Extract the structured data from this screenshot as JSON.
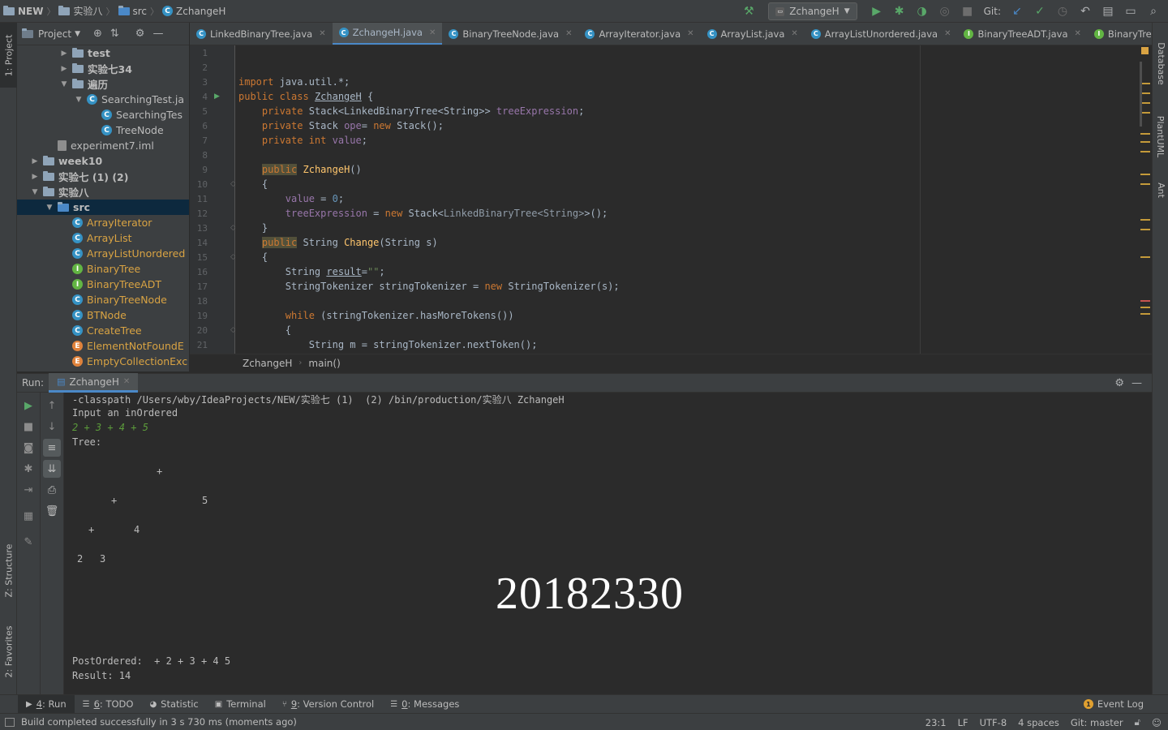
{
  "nav": {
    "crumbs": [
      "NEW",
      "实验八",
      "src",
      "ZchangeH"
    ],
    "run_config": "ZchangeH",
    "git_label": "Git:"
  },
  "left_strip": {
    "project": "1: Project",
    "structure": "Z: Structure",
    "favorites": "2: Favorites"
  },
  "right_strip": {
    "database": "Database",
    "plantuml": "PlantUML",
    "ant": "Ant"
  },
  "project_panel": {
    "title": "Project",
    "tree": [
      {
        "label": "test",
        "kind": "folder",
        "depth": 3,
        "arrow": "▶"
      },
      {
        "label": "实验七34",
        "kind": "folder",
        "depth": 3,
        "arrow": "▶"
      },
      {
        "label": "遍历",
        "kind": "folder",
        "depth": 3,
        "arrow": "▼"
      },
      {
        "label": "SearchingTest.ja",
        "kind": "class",
        "depth": 4,
        "arrow": "▼"
      },
      {
        "label": "SearchingTes",
        "kind": "class",
        "depth": 5,
        "arrow": ""
      },
      {
        "label": "TreeNode",
        "kind": "class",
        "depth": 5,
        "arrow": ""
      },
      {
        "label": "experiment7.iml",
        "kind": "iml",
        "depth": 2,
        "arrow": ""
      },
      {
        "label": "week10",
        "kind": "folder",
        "depth": 1,
        "arrow": "▶"
      },
      {
        "label": "实验七 (1)   (2)",
        "kind": "folder",
        "depth": 1,
        "arrow": "▶"
      },
      {
        "label": "实验八",
        "kind": "folder",
        "depth": 1,
        "arrow": "▼"
      },
      {
        "label": "src",
        "kind": "srcfolder",
        "depth": 2,
        "arrow": "▼"
      },
      {
        "label": "ArrayIterator",
        "kind": "java-c",
        "depth": 3,
        "arrow": ""
      },
      {
        "label": "ArrayList",
        "kind": "java-c",
        "depth": 3,
        "arrow": ""
      },
      {
        "label": "ArrayListUnordered",
        "kind": "java-c",
        "depth": 3,
        "arrow": ""
      },
      {
        "label": "BinaryTree",
        "kind": "java-i",
        "depth": 3,
        "arrow": ""
      },
      {
        "label": "BinaryTreeADT",
        "kind": "java-i",
        "depth": 3,
        "arrow": ""
      },
      {
        "label": "BinaryTreeNode",
        "kind": "java-c",
        "depth": 3,
        "arrow": ""
      },
      {
        "label": "BTNode",
        "kind": "java-c",
        "depth": 3,
        "arrow": ""
      },
      {
        "label": "CreateTree",
        "kind": "java-c",
        "depth": 3,
        "arrow": ""
      },
      {
        "label": "ElementNotFoundE",
        "kind": "java-e",
        "depth": 3,
        "arrow": ""
      },
      {
        "label": "EmptyCollectionExc",
        "kind": "java-e",
        "depth": 3,
        "arrow": ""
      }
    ]
  },
  "editor": {
    "tabs": [
      {
        "label": "LinkedBinaryTree.java",
        "icon": "c"
      },
      {
        "label": "ZchangeH.java",
        "icon": "c",
        "active": true
      },
      {
        "label": "BinaryTreeNode.java",
        "icon": "c"
      },
      {
        "label": "ArrayIterator.java",
        "icon": "c"
      },
      {
        "label": "ArrayList.java",
        "icon": "c"
      },
      {
        "label": "ArrayListUnordered.java",
        "icon": "c"
      },
      {
        "label": "BinaryTreeADT.java",
        "icon": "i"
      },
      {
        "label": "BinaryTree.java",
        "icon": "i"
      }
    ],
    "tab_overflow": "2",
    "line_numbers": [
      "1",
      "2",
      "3",
      "4",
      "5",
      "6",
      "7",
      "8",
      "9",
      "10",
      "11",
      "12",
      "13",
      "14",
      "15",
      "16",
      "17",
      "18",
      "19",
      "20",
      "21"
    ],
    "breadcrumb": [
      "ZchangeH",
      "main()"
    ]
  },
  "run": {
    "label": "Run:",
    "tab": "ZchangeH",
    "console": {
      "classpath": "-classpath /Users/wby/IdeaProjects/NEW/实验七 (1)  (2) /bin/production/实验八 ZchangeH",
      "prompt": "Input an inOrdered",
      "input": "2 + 3 + 4 + 5",
      "tree_label": "Tree:",
      "tree_nodes": [
        "+",
        "+",
        "5",
        "+",
        "4",
        "2",
        "3"
      ],
      "postordered": "PostOrdered:  + 2 + 3 + 4 5",
      "result": "Result: 14",
      "watermark": "20182330"
    }
  },
  "bottom_tabs": [
    {
      "num": "4",
      "label": ": Run",
      "active": true
    },
    {
      "num": "6",
      "label": ": TODO"
    },
    {
      "num": "",
      "label": "Statistic"
    },
    {
      "num": "",
      "label": "Terminal"
    },
    {
      "num": "9",
      "label": ": Version Control"
    },
    {
      "num": "0",
      "label": ": Messages"
    }
  ],
  "event_log": "Event Log",
  "status": {
    "message": "Build completed successfully in 3 s 730 ms (moments ago)",
    "position": "23:1",
    "line_sep": "LF",
    "encoding": "UTF-8",
    "indent": "4 spaces",
    "git": "Git: master"
  },
  "colors": {
    "accent": "#4a88c7",
    "keyword": "#cc7832",
    "field": "#9876aa",
    "run_green": "#59a869"
  }
}
